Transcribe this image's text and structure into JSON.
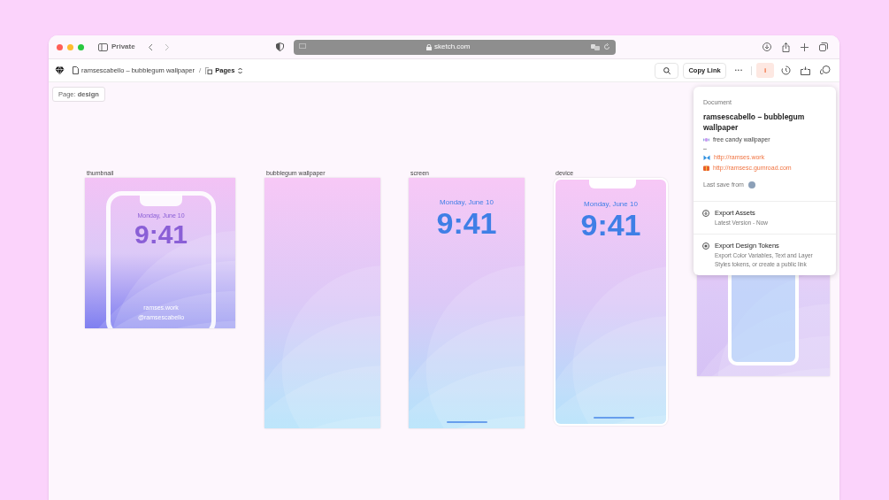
{
  "browser": {
    "mode_label": "Private",
    "url": "sketch.com"
  },
  "app_bar": {
    "document": "ramsescabello – bubblegum wallpaper",
    "separator": "/",
    "pages": "Pages",
    "copy_link": "Copy Link",
    "more": "•••",
    "info": {
      "label": "i",
      "selected": true
    }
  },
  "page_label": "Page: **design**",
  "artboards": [
    {
      "kind": "thumbnail",
      "label": "thumbnail",
      "date": "Monday, June 10",
      "time": "9:41",
      "footer": [
        "ramses.work",
        "@ramsescabello"
      ]
    },
    {
      "kind": "wallpaper",
      "label": "bubblegum wallpaper"
    },
    {
      "kind": "screen",
      "label": "screen",
      "date": "Monday, June 10",
      "time": "9:41"
    },
    {
      "kind": "device",
      "label": "device",
      "date": "Monday, June 10",
      "time": "9:41"
    },
    {
      "kind": "mockup"
    }
  ],
  "popover": {
    "heading": "Document",
    "title": "ramsescabello – bubblegum wallpaper",
    "lines": [
      {
        "kind": "text",
        "text": "free candy wallpaper"
      },
      {
        "kind": "plain",
        "text": "–"
      },
      {
        "kind": "link",
        "text": "http://ramses.work"
      },
      {
        "kind": "link",
        "text": "http://ramsesc.gumroad.com"
      }
    ],
    "last_save": "Last save from",
    "actions": [
      {
        "title": "Export Assets",
        "subtitle": "Latest Version - Now"
      },
      {
        "title": "Export Design Tokens",
        "subtitle": "Export Color Variables, Text and Layer Styles tokens, or create a public link"
      }
    ]
  }
}
